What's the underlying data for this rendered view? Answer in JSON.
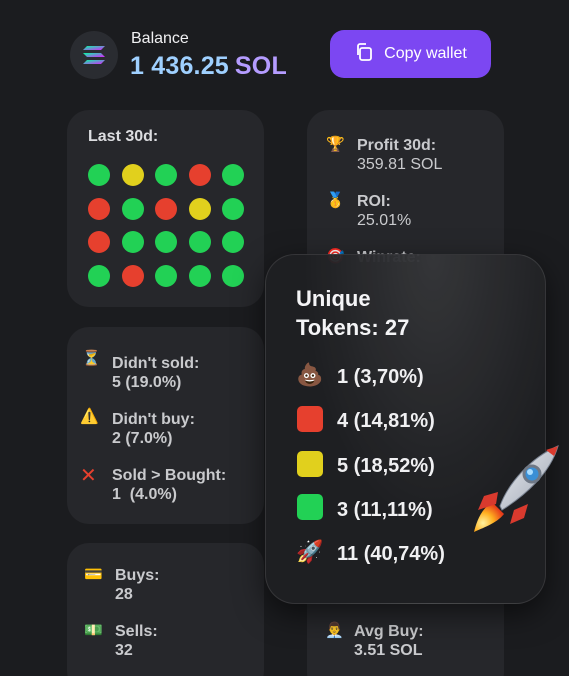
{
  "header": {
    "balance_label": "Balance",
    "balance_amount": "1 436.25",
    "balance_unit": "SOL",
    "copy_button": "Copy wallet"
  },
  "last30d": {
    "title": "Last 30d:",
    "grid": [
      [
        "green",
        "yellow",
        "green",
        "red",
        "green"
      ],
      [
        "red",
        "green",
        "red",
        "yellow",
        "green"
      ],
      [
        "red",
        "green",
        "green",
        "green",
        "green"
      ],
      [
        "green",
        "red",
        "green",
        "green",
        "green"
      ]
    ]
  },
  "profit_card": {
    "profit_label": "Profit 30d:",
    "profit_value": "359.81 SOL",
    "roi_label": "ROI:",
    "roi_value": "25.01%",
    "winrate_label": "Winrate:"
  },
  "status_card": {
    "didnt_sold_label": "Didn't sold:",
    "didnt_sold_value": "5 (19.0%)",
    "didnt_buy_label": "Didn't buy:",
    "didnt_buy_value": "2 (7.0%)",
    "sold_bought_label": "Sold > Bought:",
    "sold_bought_value": "1  (4.0%)"
  },
  "trades_card": {
    "buys_label": "Buys:",
    "buys_value": "28",
    "sells_label": "Sells:",
    "sells_value": "32"
  },
  "avg_card": {
    "avg_buy_label": "Avg Buy:",
    "avg_buy_value": "3.51 SOL"
  },
  "popup": {
    "title_line1": "Unique",
    "title_line2": "Tokens: 27",
    "rows": [
      {
        "icon": "poop-emoji",
        "value": "1 (3,70%)"
      },
      {
        "icon": "red-square",
        "value": "4 (14,81%)"
      },
      {
        "icon": "yellow-square",
        "value": "5 (18,52%)"
      },
      {
        "icon": "green-square",
        "value": "3 (11,11%)"
      },
      {
        "icon": "rocket-emoji",
        "value": "11 (40,74%)"
      }
    ]
  },
  "colors": {
    "green": "#22d155",
    "red": "#e6402e",
    "yellow": "#e1d01d",
    "accent": "#7c47f2"
  }
}
